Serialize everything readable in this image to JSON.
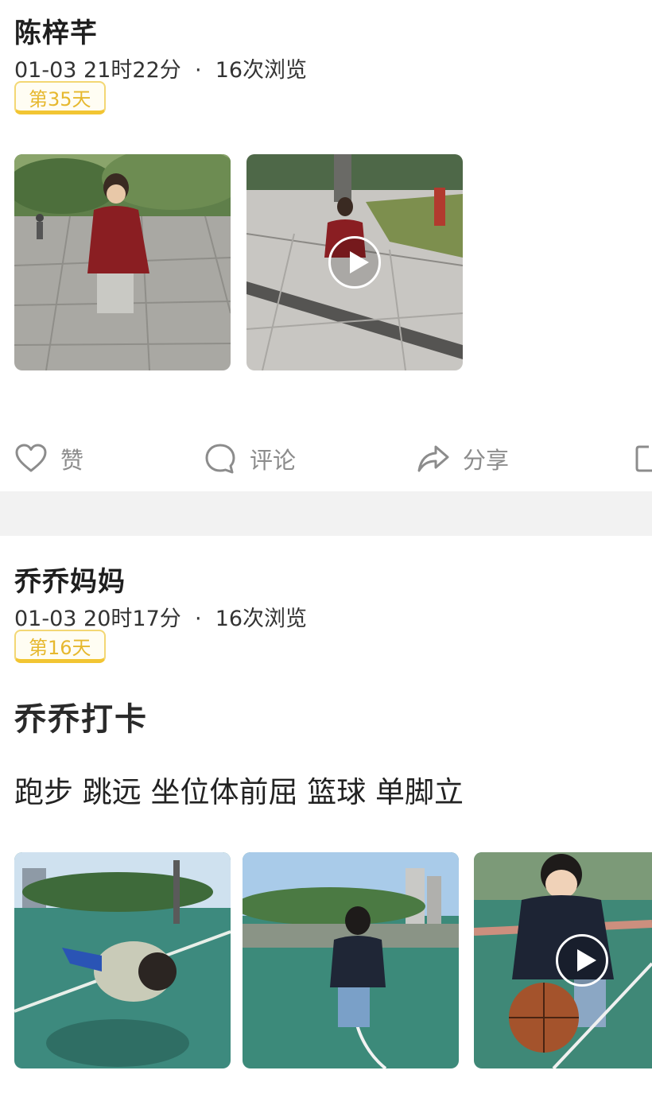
{
  "posts": [
    {
      "author": "陈梓芊",
      "time": "01-03 21时22分",
      "separator": "·",
      "views": "16次浏览",
      "day_badge": "第35天",
      "media": [
        {
          "type": "photo",
          "subject": "toddler in red jacket on paved plaza"
        },
        {
          "type": "video",
          "subject": "toddler walking on paved path by lawn"
        }
      ],
      "actions": {
        "like_label": "赞",
        "comment_label": "评论",
        "share_label": "分享"
      }
    },
    {
      "author": "乔乔妈妈",
      "time": "01-03 20时17分",
      "separator": "·",
      "views": "16次浏览",
      "day_badge": "第16天",
      "title": "乔乔打卡",
      "text": "跑步 跳远 坐位体前屈 篮球 单脚立",
      "media": [
        {
          "type": "photo",
          "subject": "child crawling on basketball court"
        },
        {
          "type": "photo",
          "subject": "child running on basketball court"
        },
        {
          "type": "video",
          "subject": "child with basketball"
        }
      ]
    }
  ],
  "icons": {
    "like": "heart-icon",
    "comment": "comment-bubble-icon",
    "share": "share-arrow-icon",
    "more": "edit-icon"
  },
  "colors": {
    "badge_text": "#e6b82e",
    "badge_border": "#f2c533",
    "action_gray": "#8c8c8c",
    "separator_bg": "#f2f2f2"
  }
}
